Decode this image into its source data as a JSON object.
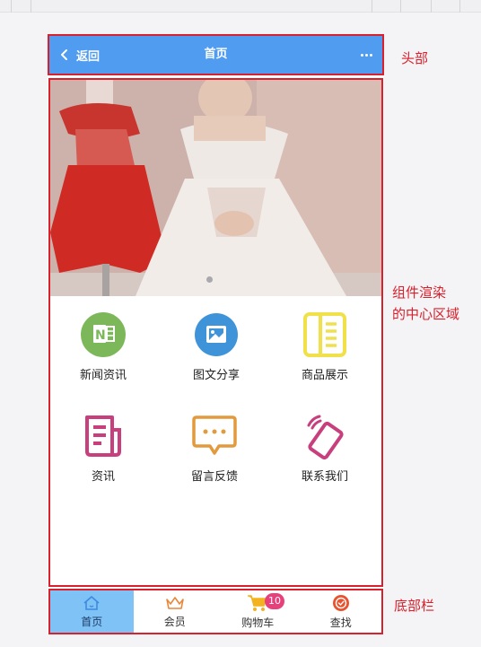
{
  "header": {
    "back_label": "返回",
    "title": "首页",
    "color": "#4f9cf0"
  },
  "grid": [
    {
      "label": "新闻资讯",
      "icon": "news-icon"
    },
    {
      "label": "图文分享",
      "icon": "image-share-icon"
    },
    {
      "label": "商品展示",
      "icon": "product-display-icon"
    },
    {
      "label": "资讯",
      "icon": "info-icon"
    },
    {
      "label": "留言反馈",
      "icon": "message-feedback-icon"
    },
    {
      "label": "联系我们",
      "icon": "contact-phone-icon"
    }
  ],
  "tabbar": {
    "items": [
      {
        "label": "首页",
        "icon": "home-icon",
        "active": true
      },
      {
        "label": "会员",
        "icon": "crown-icon",
        "active": false
      },
      {
        "label": "购物车",
        "icon": "cart-icon",
        "active": false,
        "badge": "10"
      },
      {
        "label": "查找",
        "icon": "search-check-icon",
        "active": false
      }
    ]
  },
  "annotations": {
    "header": "头部",
    "center_line1": "组件渲染",
    "center_line2": "的中心区域",
    "footer": "底部栏"
  },
  "colors": {
    "annotation": "#d9202c",
    "tab_active": "#7fc2f6",
    "badge": "#e8407b"
  }
}
